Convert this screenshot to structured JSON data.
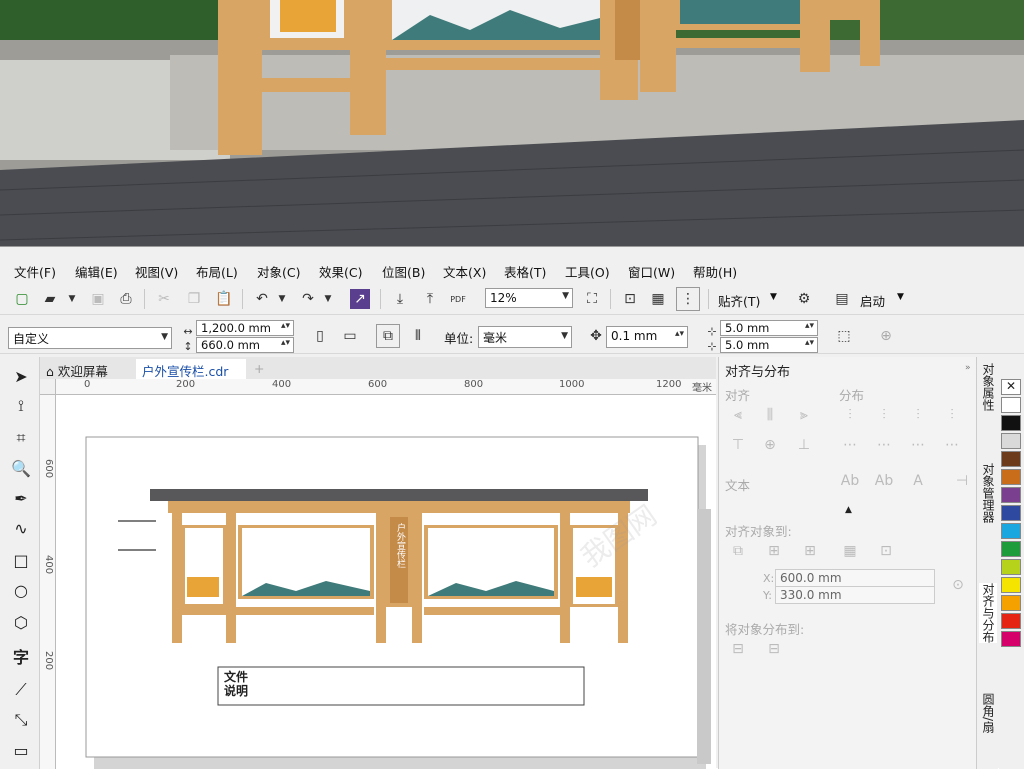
{
  "menu": [
    "文件(F)",
    "编辑(E)",
    "视图(V)",
    "布局(L)",
    "对象(C)",
    "效果(C)",
    "位图(B)",
    "文本(X)",
    "表格(T)",
    "工具(O)",
    "窗口(W)",
    "帮助(H)"
  ],
  "toolbar": {
    "pdf_label": "PDF",
    "zoom": "12%",
    "snap_label": "贴齐(T)",
    "launch_label": "启动"
  },
  "property_bar": {
    "page_preset": "自定义",
    "width": "1,200.0 mm",
    "height": "660.0 mm",
    "unit_label": "单位:",
    "unit": "毫米",
    "nudge": "0.1 mm",
    "dup_x": "5.0 mm",
    "dup_y": "5.0 mm"
  },
  "tabs": {
    "welcome": "欢迎屏幕",
    "document": "户外宣传栏.cdr",
    "add": "+"
  },
  "ruler": {
    "h_ticks": [
      "0",
      "200",
      "400",
      "600",
      "800",
      "1000",
      "1200"
    ],
    "h_unit": "毫米",
    "v_ticks": [
      "600",
      "400",
      "200"
    ]
  },
  "design": {
    "center_panel_text": "户外宣传栏",
    "note_title_line1": "文件",
    "note_title_line2": "说明",
    "watermark": "我图网"
  },
  "docker": {
    "title": "对齐与分布",
    "align_label": "对齐",
    "distribute_label": "分布",
    "text_label": "文本",
    "align_to_label": "对齐对象到:",
    "x_label": "X:",
    "x_value": "600.0 mm",
    "y_label": "Y:",
    "y_value": "330.0 mm",
    "distribute_to_label": "将对象分布到:"
  },
  "side_tabs": [
    "对象属性",
    "对象管理器",
    "对齐与分布",
    "圆角/扇"
  ],
  "palette": [
    "#ffffff",
    "#111111",
    "#d9d9d9",
    "#6b3b1c",
    "#c96d1a",
    "#7a3f8f",
    "#2d4aa0",
    "#1aa7e0",
    "#1e9c3c",
    "#b6d21b",
    "#f5e400",
    "#f5a100",
    "#e52414",
    "#d6006a"
  ]
}
